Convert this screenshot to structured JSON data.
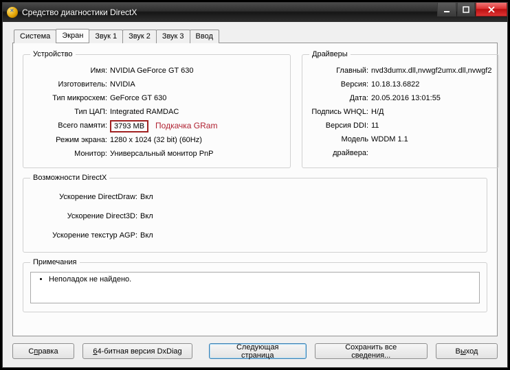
{
  "window": {
    "title": "Средство диагностики DirectX"
  },
  "tabs": [
    "Система",
    "Экран",
    "Звук 1",
    "Звук 2",
    "Звук 3",
    "Ввод"
  ],
  "active_tab_index": 1,
  "device": {
    "legend": "Устройство",
    "labels": {
      "name": "Имя:",
      "vendor": "Изготовитель:",
      "chip": "Тип микросхем:",
      "dac": "Тип ЦАП:",
      "mem": "Всего памяти:",
      "mode": "Режим экрана:",
      "monitor": "Монитор:"
    },
    "name": "NVIDIA GeForce GT 630",
    "vendor": "NVIDIA",
    "chip": "GeForce GT 630",
    "dac": "Integrated RAMDAC",
    "mem": "3793 МВ",
    "mode": "1280 x 1024 (32 bit) (60Hz)",
    "monitor": "Универсальный монитор PnP"
  },
  "annotation": "Подкачка GRam",
  "drivers": {
    "legend": "Драйверы",
    "labels": {
      "main": "Главный:",
      "version": "Версия:",
      "date": "Дата:",
      "whql": "Подпись WHQL:",
      "ddi": "Версия DDI:",
      "model": "Модель драйвера:"
    },
    "main": "nvd3dumx.dll,nvwgf2umx.dll,nvwgf2",
    "version": "10.18.13.6822",
    "date": "20.05.2016 13:01:55",
    "whql": "Н/Д",
    "ddi": "11",
    "model": "WDDM 1.1"
  },
  "dxcap": {
    "legend": "Возможности DirectX",
    "labels": {
      "ddraw": "Ускорение DirectDraw:",
      "d3d": "Ускорение Direct3D:",
      "agp": "Ускорение текстур AGP:"
    },
    "ddraw": "Вкл",
    "d3d": "Вкл",
    "agp": "Вкл"
  },
  "notes": {
    "legend": "Примечания",
    "text": "Неполадок не найдено."
  },
  "buttons": {
    "help_pre": "С",
    "help_accel": "п",
    "help_post": "равка",
    "bit64_accel": "6",
    "bit64_post": "4-битная версия DxDiag",
    "next": "Следующая страница",
    "save": "Сохранить все сведения...",
    "exit_pre": "В",
    "exit_accel": "ы",
    "exit_post": "ход"
  }
}
